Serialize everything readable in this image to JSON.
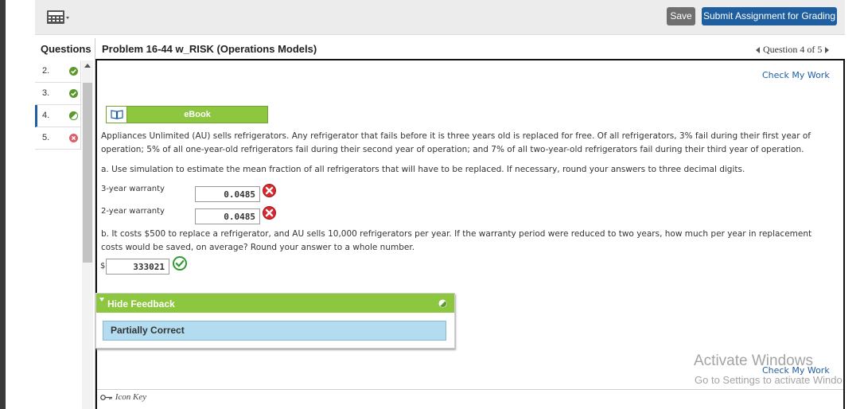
{
  "toolbar": {
    "calculator_icon": "calculator-icon",
    "save_label": "Save",
    "submit_label": "Submit Assignment for Grading"
  },
  "sidebar": {
    "header": "Questions",
    "items": [
      {
        "number": "2.",
        "status": "correct",
        "active": false
      },
      {
        "number": "3.",
        "status": "correct",
        "active": false
      },
      {
        "number": "4.",
        "status": "partial",
        "active": true
      },
      {
        "number": "5.",
        "status": "incorrect",
        "active": false
      }
    ]
  },
  "problem": {
    "title": "Problem 16-44 w_RISK (Operations Models)",
    "question_nav": "Question 4 of 5",
    "check_my_work": "Check My Work",
    "ebook_label": "eBook",
    "intro_line1": "Appliances Unlimited (AU) sells refrigerators. Any refrigerator that fails before it is three years old is replaced for free. Of all refrigerators, 3% fail during their first year of",
    "intro_line2": "operation; 5% of all one-year-old refrigerators fail during their second year of operation; and 7% of all two-year-old refrigerators fail during their third year of operation.",
    "part_a": "a. Use simulation to estimate the mean fraction of all refrigerators that will have to be replaced. If necessary, round your answers to three decimal digits.",
    "answers_a": [
      {
        "label": "3-year warranty",
        "value": "0.0485",
        "status": "incorrect"
      },
      {
        "label": "2-year warranty",
        "value": "0.0485",
        "status": "incorrect"
      }
    ],
    "part_b_line1": "b. It costs $500 to replace a refrigerator, and AU sells 10,000 refrigerators per year. If the warranty period were reduced to two years, how much per year in replacement",
    "part_b_line2": "costs would be saved, on average? Round your answer to a whole number.",
    "answer_b": {
      "prefix": "$",
      "value": "333021",
      "status": "correct"
    }
  },
  "feedback": {
    "header": "Hide Feedback",
    "result": "Partially Correct"
  },
  "footer": {
    "check_my_work": "Check My Work",
    "icon_key": "Icon Key"
  },
  "watermark": {
    "line1": "Activate Windows",
    "line2": "Go to Settings to activate Windo"
  },
  "colors": {
    "green": "#8dc63f",
    "blue": "#1f5fa0",
    "error_red": "#d9282f",
    "success_green": "#2f9a2f",
    "feedback_blue": "#b3dcf0"
  }
}
